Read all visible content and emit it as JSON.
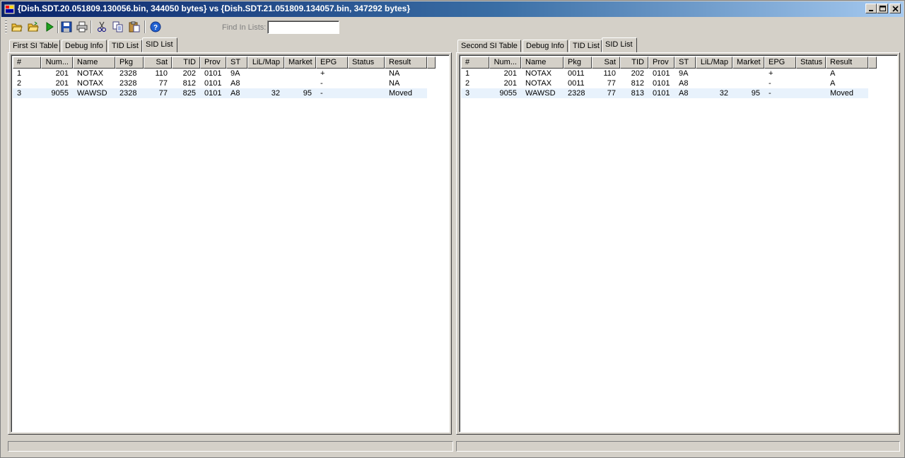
{
  "window": {
    "title": "{Dish.SDT.20.051809.130056.bin, 344050 bytes} vs {Dish.SDT.21.051809.134057.bin, 347292 bytes}"
  },
  "toolbar": {
    "buttons": [
      "open-folder-icon",
      "open-icon",
      "run-icon",
      "save-icon",
      "print-icon",
      "cut-icon",
      "copy-icon",
      "paste-icon",
      "help-icon"
    ],
    "find_label": "Find In Lists:",
    "find_value": ""
  },
  "left": {
    "tabs": [
      "First SI Table",
      "Debug Info",
      "TID List",
      "SID List"
    ],
    "active_tab": 3,
    "columns": [
      "#",
      "Num...",
      "Name",
      "Pkg",
      "Sat",
      "TID",
      "Prov",
      "ST",
      "LiL/Map",
      "Market",
      "EPG",
      "Status",
      "Result"
    ],
    "rows": [
      [
        "1",
        "201",
        "NOTAX",
        "2328",
        "110",
        "202",
        "0101",
        "9A",
        "",
        "",
        "+",
        "",
        "NA"
      ],
      [
        "2",
        "201",
        "NOTAX",
        "2328",
        "77",
        "812",
        "0101",
        "A8",
        "",
        "",
        "-",
        "",
        "NA"
      ],
      [
        "3",
        "9055",
        "WAWSD",
        "2328",
        "77",
        "825",
        "0101",
        "A8",
        "32",
        "95",
        "-",
        "",
        "Moved"
      ]
    ]
  },
  "right": {
    "tabs": [
      "Second SI Table",
      "Debug Info",
      "TID List",
      "SID List"
    ],
    "active_tab": 3,
    "columns": [
      "#",
      "Num...",
      "Name",
      "Pkg",
      "Sat",
      "TID",
      "Prov",
      "ST",
      "LiL/Map",
      "Market",
      "EPG",
      "Status",
      "Result"
    ],
    "rows": [
      [
        "1",
        "201",
        "NOTAX",
        "0011",
        "110",
        "202",
        "0101",
        "9A",
        "",
        "",
        "+",
        "",
        "A"
      ],
      [
        "2",
        "201",
        "NOTAX",
        "0011",
        "77",
        "812",
        "0101",
        "A8",
        "",
        "",
        "-",
        "",
        "A"
      ],
      [
        "3",
        "9055",
        "WAWSD",
        "2328",
        "77",
        "813",
        "0101",
        "A8",
        "32",
        "95",
        "-",
        "",
        "Moved"
      ]
    ]
  },
  "colors": {
    "titlebar_start": "#0a246a",
    "titlebar_end": "#a6caf0",
    "selected_row": "#e8f2fc",
    "face": "#d4d0c8"
  }
}
